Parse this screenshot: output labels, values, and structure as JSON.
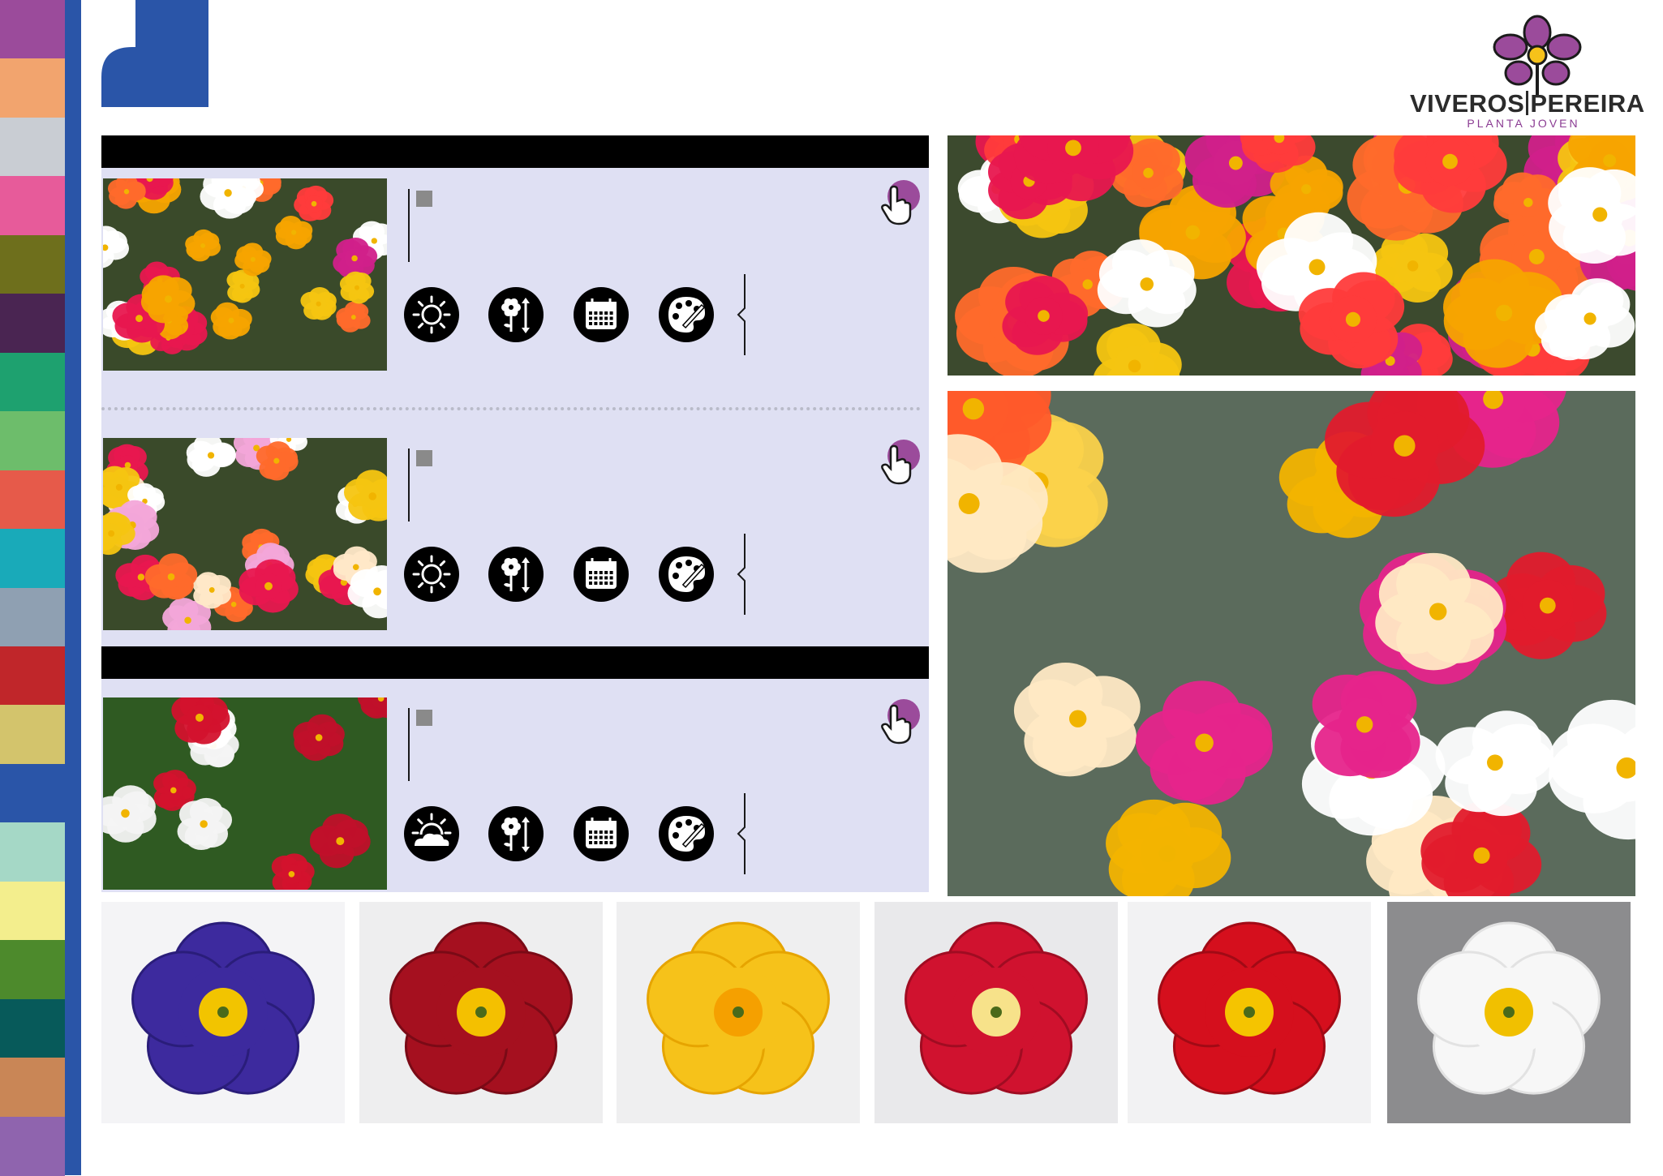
{
  "brand": {
    "name_left": "VIVEROS",
    "name_right": "PEREIRA",
    "tagline": "PLANTA JOVEN",
    "accent_color": "#8b3c93",
    "blue": "#2a55a8"
  },
  "color_strip": [
    "#9b4b9b",
    "#f2a46e",
    "#c9cdd3",
    "#e75b9a",
    "#6e6f1c",
    "#4a2552",
    "#1ea16f",
    "#6dbd6b",
    "#e65a4a",
    "#19aab9",
    "#8fa0b2",
    "#c0262a",
    "#d3c46c",
    "#2a55a8",
    "#a5d8c6",
    "#f3ee8d",
    "#4d8a2c",
    "#075a5a",
    "#c98656",
    "#8f64ae"
  ],
  "products": [
    {
      "id": "portulaca-1",
      "icons": [
        "sun-icon",
        "flower-height-icon",
        "calendar-icon",
        "palette-icon"
      ]
    },
    {
      "id": "portulaca-2",
      "icons": [
        "sun-icon",
        "flower-height-icon",
        "calendar-icon",
        "palette-icon"
      ]
    },
    {
      "id": "primula-1",
      "icons": [
        "partial-sun-icon",
        "flower-height-icon",
        "calendar-icon",
        "palette-icon"
      ]
    }
  ],
  "swatches": [
    {
      "petal": "#3d2a9e",
      "petal_dark": "#2a1d7a",
      "center": "#f2c400",
      "bg": "#f4f4f6"
    },
    {
      "petal": "#a5101f",
      "petal_dark": "#7a0a16",
      "center": "#f4c000",
      "bg": "#eeeeef"
    },
    {
      "petal": "#f6c21a",
      "petal_dark": "#e6a400",
      "center": "#f5a000",
      "bg": "#efeff0"
    },
    {
      "petal": "#d0122f",
      "petal_dark": "#a00c22",
      "center": "#f7e28a",
      "bg": "#e9e9eb"
    },
    {
      "petal": "#d50f1d",
      "petal_dark": "#a10a15",
      "center": "#f5c400",
      "bg": "#f2f2f3"
    },
    {
      "petal": "#f7f7f7",
      "petal_dark": "#e2e2e2",
      "center": "#f1c000",
      "bg": "#8c8c8e"
    }
  ]
}
